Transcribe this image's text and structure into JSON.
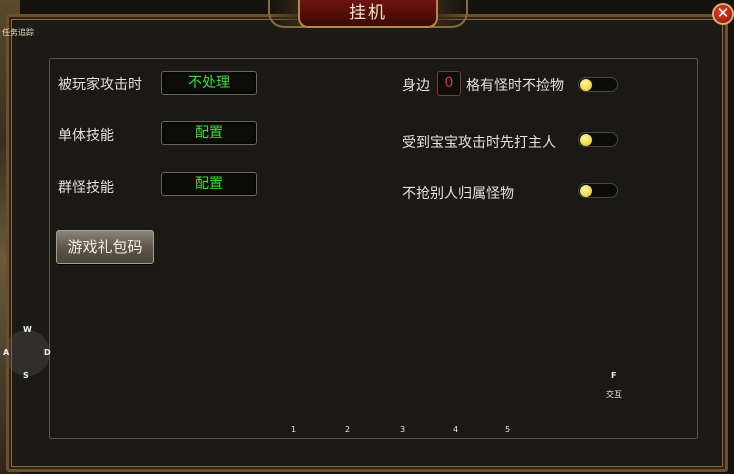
{
  "window": {
    "title": "挂机",
    "close_glyph": "✕",
    "corner_tag": "任务追踪"
  },
  "settings": {
    "when_attacked_label": "被玩家攻击时",
    "when_attacked_value": "不处理",
    "single_skill_label": "单体技能",
    "single_skill_value": "配置",
    "group_skill_label": "群怪技能",
    "group_skill_value": "配置",
    "gift_code_button": "游戏礼包码",
    "nearby_prefix": "身边",
    "nearby_count": "0",
    "nearby_suffix": "格有怪时不捡物",
    "pet_attacked_label": "受到宝宝攻击时先打主人",
    "no_steal_label": "不抢别人归属怪物"
  },
  "toggles": {
    "no_pickup": true,
    "pet_attacked": true,
    "no_steal": true
  },
  "hud": {
    "wasd": {
      "w": "W",
      "a": "A",
      "s": "S",
      "d": "D"
    },
    "interact_key": "F",
    "interact_label": "交互",
    "hotkeys": [
      "1",
      "2",
      "3",
      "4",
      "5"
    ]
  },
  "colors": {
    "value_green": "#3ddc3a",
    "count_red": "#e23a2a",
    "toggle_knob": "#f2e040",
    "title_banner": "#6e1410"
  },
  "icons": [
    "close-icon",
    "toggle-knob"
  ]
}
